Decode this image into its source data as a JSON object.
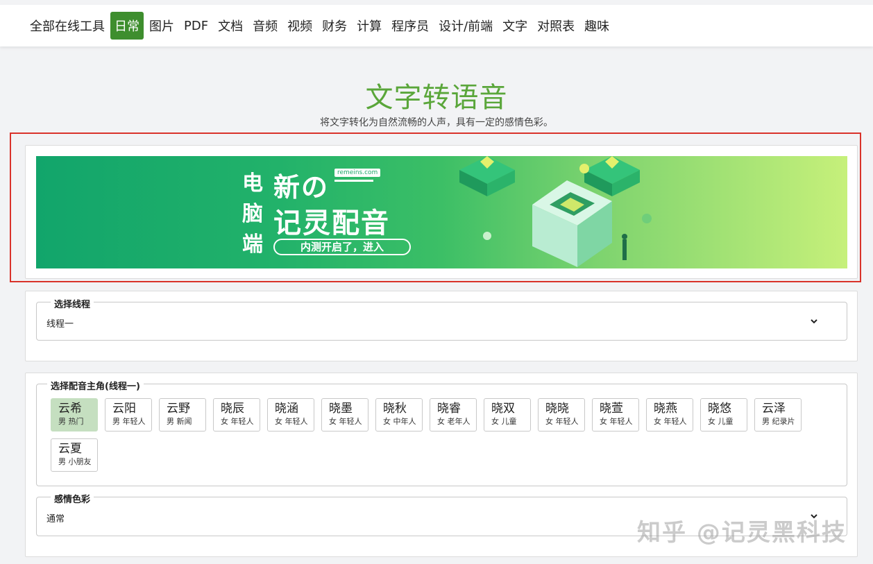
{
  "nav": {
    "items": [
      {
        "label": "全部在线工具",
        "active": false
      },
      {
        "label": "日常",
        "active": true
      },
      {
        "label": "图片",
        "active": false
      },
      {
        "label": "PDF",
        "active": false
      },
      {
        "label": "文档",
        "active": false
      },
      {
        "label": "音频",
        "active": false
      },
      {
        "label": "视频",
        "active": false
      },
      {
        "label": "财务",
        "active": false
      },
      {
        "label": "计算",
        "active": false
      },
      {
        "label": "程序员",
        "active": false
      },
      {
        "label": "设计/前端",
        "active": false
      },
      {
        "label": "文字",
        "active": false
      },
      {
        "label": "对照表",
        "active": false
      },
      {
        "label": "趣味",
        "active": false
      }
    ]
  },
  "header": {
    "title": "文字转语音",
    "subtitle": "将文字转化为自然流畅的人声，具有一定的感情色彩。"
  },
  "banner": {
    "vertical_text": [
      "电",
      "脑",
      "端"
    ],
    "line1": "新の",
    "url": "remeins.com",
    "line2": "记灵配音",
    "pill": "内测开启了，进入"
  },
  "thread_select": {
    "legend": "选择线程",
    "value": "线程一"
  },
  "voices": {
    "legend": "选择配音主角(线程一)",
    "items": [
      {
        "name": "云希",
        "tag": "男 热门",
        "selected": true
      },
      {
        "name": "云阳",
        "tag": "男 年轻人",
        "selected": false
      },
      {
        "name": "云野",
        "tag": "男 新闻",
        "selected": false
      },
      {
        "name": "晓辰",
        "tag": "女 年轻人",
        "selected": false
      },
      {
        "name": "晓涵",
        "tag": "女 年轻人",
        "selected": false
      },
      {
        "name": "晓墨",
        "tag": "女 年轻人",
        "selected": false
      },
      {
        "name": "晓秋",
        "tag": "女 中年人",
        "selected": false
      },
      {
        "name": "晓睿",
        "tag": "女 老年人",
        "selected": false
      },
      {
        "name": "晓双",
        "tag": "女 儿童",
        "selected": false
      },
      {
        "name": "晓晓",
        "tag": "女 年轻人",
        "selected": false
      },
      {
        "name": "晓萱",
        "tag": "女 年轻人",
        "selected": false
      },
      {
        "name": "晓燕",
        "tag": "女 年轻人",
        "selected": false
      },
      {
        "name": "晓悠",
        "tag": "女 儿童",
        "selected": false
      },
      {
        "name": "云泽",
        "tag": "男 纪录片",
        "selected": false
      },
      {
        "name": "云夏",
        "tag": "男 小朋友",
        "selected": false
      }
    ]
  },
  "emotion_select": {
    "legend": "感情色彩",
    "value": "通常"
  },
  "watermark": "知乎 @记灵黑科技",
  "colors": {
    "accent": "#3e8e2e",
    "title": "#5aa63a",
    "highlight_border": "#d9322a",
    "selected_voice": "#c5dfc0"
  }
}
